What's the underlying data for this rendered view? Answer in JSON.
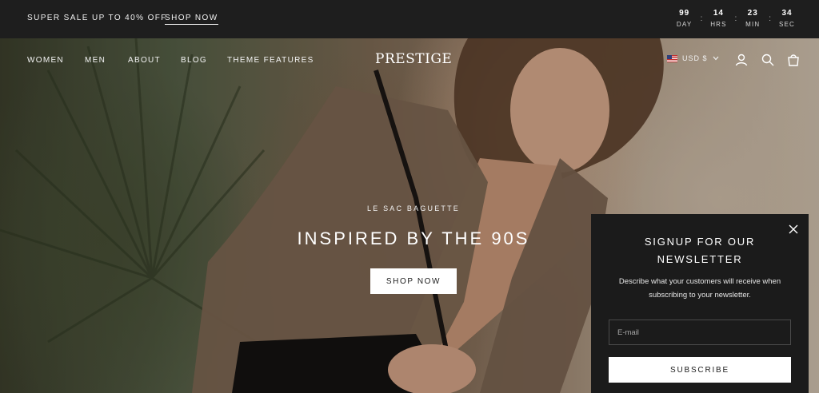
{
  "announcement": {
    "promo_text": "SUPER SALE UP TO 40% OFF",
    "promo_link": "SHOP NOW",
    "countdown": [
      {
        "value": "99",
        "label": "DAY"
      },
      {
        "value": "14",
        "label": "HRS"
      },
      {
        "value": "23",
        "label": "MIN"
      },
      {
        "value": "34",
        "label": "SEC"
      }
    ]
  },
  "nav": {
    "items": [
      "WOMEN",
      "MEN",
      "ABOUT",
      "BLOG",
      "THEME FEATURES"
    ],
    "logo": "PRESTIGE",
    "currency": "USD $",
    "icons": [
      "account-icon",
      "search-icon",
      "cart-icon"
    ]
  },
  "hero": {
    "eyebrow": "LE SAC BAGUETTE",
    "headline": "INSPIRED BY THE 90S",
    "button_label": "SHOP NOW"
  },
  "newsletter": {
    "title_line1": "SIGNUP FOR OUR",
    "title_line2": "NEWSLETTER",
    "description": "Describe what your customers will receive when subscribing to your newsletter.",
    "email_placeholder": "E-mail",
    "button_label": "SUBSCRIBE"
  }
}
